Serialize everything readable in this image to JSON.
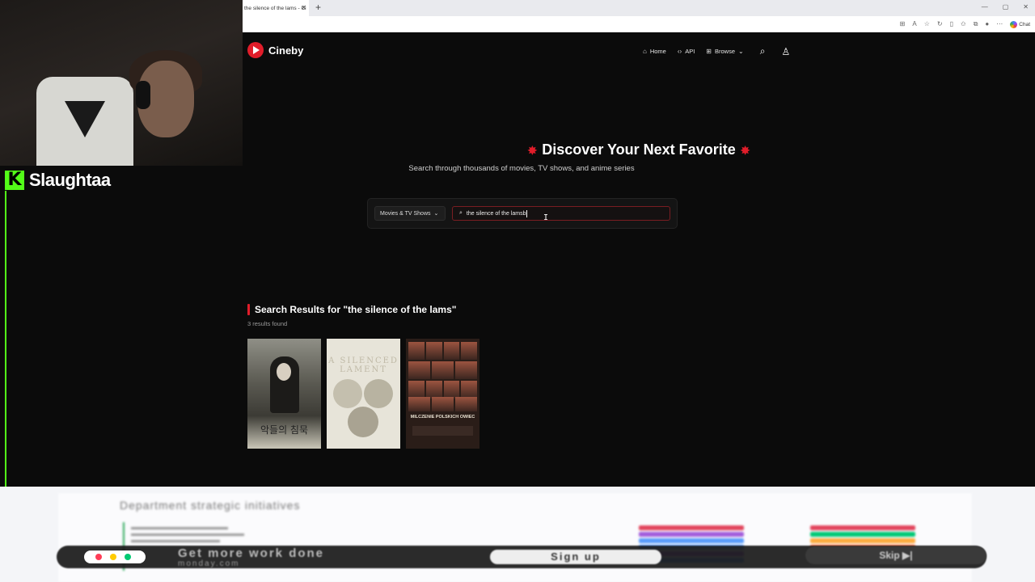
{
  "stream": {
    "platform_logo": "K",
    "streamer_name": "Slaughtaa"
  },
  "browser": {
    "tab_title": "the silence of the lams - Ci",
    "tab_close": "✕",
    "new_tab": "+",
    "copilot_label": "Chat"
  },
  "site": {
    "brand": "Cineby",
    "nav": [
      {
        "label": "Home",
        "icon": "home-icon"
      },
      {
        "label": "API",
        "icon": "code-icon"
      },
      {
        "label": "Browse",
        "icon": "grid-icon"
      }
    ],
    "hero": {
      "title": "Discover Your Next Favorite",
      "subtitle": "Search through thousands of movies, TV shows, and anime series"
    },
    "search": {
      "category": "Movies & TV Shows",
      "query": "the silence of the lamsb"
    },
    "results": {
      "heading": "Search Results for \"the silence of the lams\"",
      "count": "3 results found",
      "posters": [
        {
          "text": "악들의 침묵"
        },
        {
          "text": "A SILENCED LAMENT"
        },
        {
          "text": "MILCZENIE POLSKICH OWIEC"
        }
      ]
    },
    "accent_color": "#e11d2a"
  },
  "ad": {
    "heading": "Department strategic initiatives",
    "headline": "Get more work done",
    "domain": "monday.com",
    "signup_label": "Sign up",
    "skip_label": "Skip ▶|"
  }
}
